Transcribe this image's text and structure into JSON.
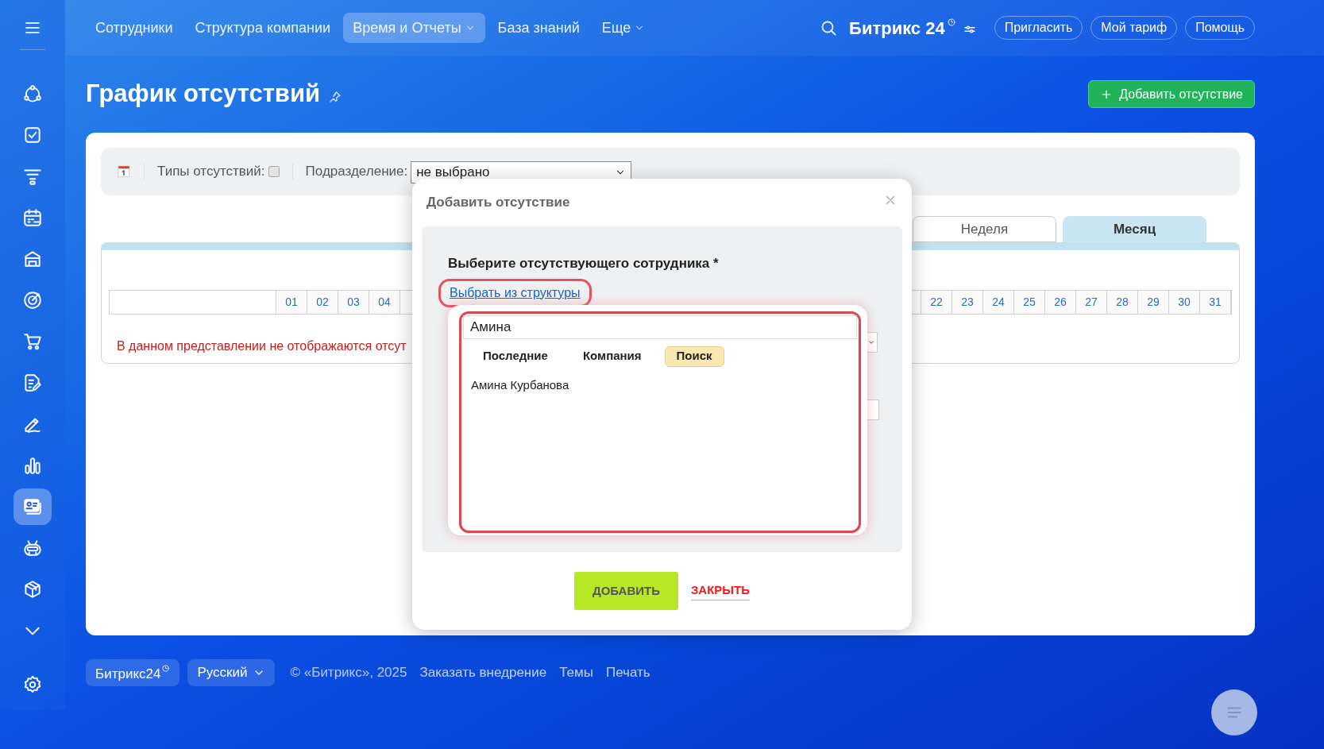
{
  "sidebar": {
    "items": [
      {
        "selected": false
      },
      {
        "selected": false
      },
      {
        "selected": false
      },
      {
        "selected": false
      },
      {
        "selected": false
      },
      {
        "selected": false
      },
      {
        "selected": false
      },
      {
        "selected": false
      },
      {
        "selected": false
      },
      {
        "selected": false
      },
      {
        "selected": true
      },
      {
        "selected": false
      },
      {
        "selected": false
      },
      {
        "selected": false
      },
      {
        "selected": false
      }
    ]
  },
  "top_nav": {
    "items": [
      {
        "label": "Сотрудники",
        "selected": false,
        "dropdown": false
      },
      {
        "label": "Структура компании",
        "selected": false,
        "dropdown": false
      },
      {
        "label": "Время и Отчеты",
        "selected": true,
        "dropdown": true
      },
      {
        "label": "База знаний",
        "selected": false,
        "dropdown": false
      },
      {
        "label": "Еще",
        "selected": false,
        "dropdown": true
      }
    ],
    "logo": "Битрикс 24",
    "buttons": [
      "Пригласить",
      "Мой тариф",
      "Помощь"
    ]
  },
  "page": {
    "title": "График отсутствий",
    "add_button": "Добавить отсутствие"
  },
  "filter_bar": {
    "types_label": "Типы отсутствий:",
    "types_checked": false,
    "department_label": "Подразделение:",
    "department_value": "не выбрано"
  },
  "view_tabs": [
    {
      "label": "Неделя",
      "selected": false
    },
    {
      "label": "Месяц",
      "selected": true
    }
  ],
  "calendar": {
    "days_before": [
      "01",
      "02",
      "03",
      "04"
    ],
    "days_after": [
      "22",
      "23",
      "24",
      "25",
      "26",
      "27",
      "28",
      "29",
      "30",
      "31"
    ],
    "notice": "В данном представлении не отображаются отсут"
  },
  "dialog": {
    "title": "Добавить отсутствие",
    "heading": "Выберите отсутствующего сотрудника *",
    "structure_link": "Выбрать из структуры",
    "search_value": "Амина",
    "tabs": [
      {
        "label": "Последние",
        "selected": false
      },
      {
        "label": "Компания",
        "selected": false
      },
      {
        "label": "Поиск",
        "selected": true
      }
    ],
    "results": [
      "Амина Курбанова"
    ],
    "add_button": "ДОБАВИТЬ",
    "close_button": "ЗАКРЫТЬ"
  },
  "footer": {
    "brand_button": "Битрикс24",
    "language": "Русский",
    "copyright": "© «Битрикс», 2025",
    "links": [
      "Заказать внедрение",
      "Темы",
      "Печать"
    ]
  }
}
